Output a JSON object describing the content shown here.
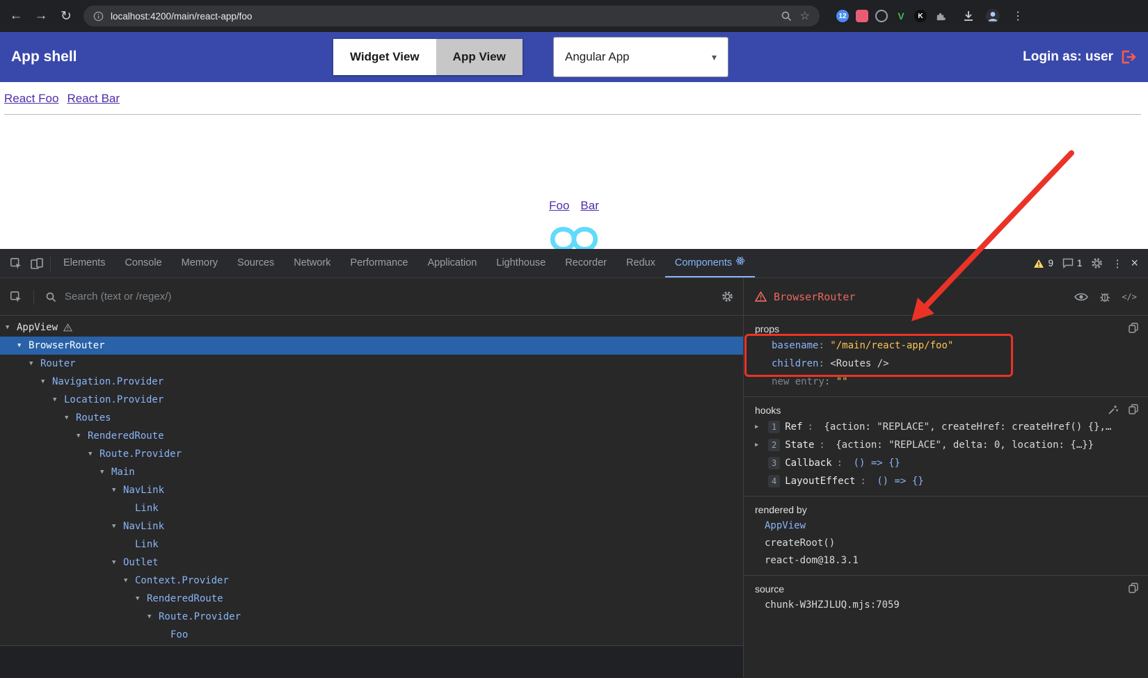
{
  "browser": {
    "url": "localhost:4200/main/react-app/foo",
    "extensions": [
      {
        "name": "updates-badge-extension-icon",
        "shape": "circle",
        "color": "#4d8bf0",
        "text_color": "#ffffff",
        "label": "12"
      },
      {
        "name": "adblock-extension-icon",
        "shape": "square",
        "color": "#e85d75",
        "text_color": "#ffffff",
        "label": ""
      },
      {
        "name": "ring-extension-icon",
        "shape": "ring",
        "color": "#9aa0a6",
        "text_color": "#9aa0a6",
        "label": ""
      },
      {
        "name": "v-extension-icon",
        "shape": "text",
        "color": "transparent",
        "text_color": "#3fba54",
        "label": "V"
      },
      {
        "name": "k-extension-icon",
        "shape": "circle",
        "color": "#101010",
        "text_color": "#ffffff",
        "label": "K"
      },
      {
        "name": "puzzle-extension-icon",
        "shape": "puzzle",
        "color": "#9aa0a6",
        "text_color": "#9aa0a6",
        "label": ""
      }
    ]
  },
  "app_header": {
    "title": "App shell",
    "view_toggle": {
      "widget_label": "Widget View",
      "app_label": "App View",
      "selected": "App View"
    },
    "app_select_value": "Angular App",
    "login_label": "Login as: user"
  },
  "page": {
    "nav_links": [
      "React Foo",
      "React Bar"
    ],
    "center_links": [
      "Foo",
      "Bar"
    ]
  },
  "devtools": {
    "tabs": [
      "Elements",
      "Console",
      "Memory",
      "Sources",
      "Network",
      "Performance",
      "Application",
      "Lighthouse",
      "Recorder",
      "Redux",
      "Components"
    ],
    "selected_tab": "Components",
    "warning_count": "9",
    "message_count": "1",
    "search_placeholder": "Search (text or /regex/)",
    "tree": [
      {
        "label": "AppView",
        "depth": 0,
        "arrow": true,
        "warning": true
      },
      {
        "label": "BrowserRouter",
        "depth": 1,
        "arrow": true,
        "selected": true
      },
      {
        "label": "Router",
        "depth": 2,
        "arrow": true
      },
      {
        "label": "Navigation.Provider",
        "depth": 3,
        "arrow": true
      },
      {
        "label": "Location.Provider",
        "depth": 4,
        "arrow": true
      },
      {
        "label": "Routes",
        "depth": 5,
        "arrow": true
      },
      {
        "label": "RenderedRoute",
        "depth": 6,
        "arrow": true
      },
      {
        "label": "Route.Provider",
        "depth": 7,
        "arrow": true
      },
      {
        "label": "Main",
        "depth": 8,
        "arrow": true
      },
      {
        "label": "NavLink",
        "depth": 9,
        "arrow": true
      },
      {
        "label": "Link",
        "depth": 10,
        "arrow": false
      },
      {
        "label": "NavLink",
        "depth": 9,
        "arrow": true
      },
      {
        "label": "Link",
        "depth": 10,
        "arrow": false
      },
      {
        "label": "Outlet",
        "depth": 9,
        "arrow": true
      },
      {
        "label": "Context.Provider",
        "depth": 10,
        "arrow": true
      },
      {
        "label": "RenderedRoute",
        "depth": 11,
        "arrow": true
      },
      {
        "label": "Route.Provider",
        "depth": 12,
        "arrow": true
      },
      {
        "label": "Foo",
        "depth": 13,
        "arrow": false
      }
    ],
    "inspector": {
      "component": "BrowserRouter",
      "props_title": "props",
      "props": [
        {
          "key": "basename",
          "value": "\"/main/react-app/foo\"",
          "kind": "string"
        },
        {
          "key": "children",
          "value": "<Routes />",
          "kind": "element"
        }
      ],
      "new_entry": {
        "key": "new entry",
        "value": "\"\""
      },
      "hooks_title": "hooks",
      "hooks": [
        {
          "index": "1",
          "name": "Ref",
          "value": "{action: \"REPLACE\", createHref: createHref() {},…",
          "expandable": true,
          "kind": "object"
        },
        {
          "index": "2",
          "name": "State",
          "value": "{action: \"REPLACE\", delta: 0, location: {…}}",
          "expandable": true,
          "kind": "object"
        },
        {
          "index": "3",
          "name": "Callback",
          "value": "() => {}",
          "expandable": false,
          "kind": "function"
        },
        {
          "index": "4",
          "name": "LayoutEffect",
          "value": "() => {}",
          "expandable": false,
          "kind": "function"
        }
      ],
      "rendered_by_title": "rendered by",
      "rendered_by": [
        {
          "label": "AppView",
          "link": true
        },
        {
          "label": "createRoot()",
          "link": false
        },
        {
          "label": "react-dom@18.3.1",
          "link": false
        }
      ],
      "source_title": "source",
      "source_value": "chunk-W3HZJLUQ.mjs:7059"
    }
  },
  "colors": {
    "header_indigo": "#3949ab",
    "annotation_red": "#ea3326",
    "selected_row_blue": "#2962a8",
    "component_error_red": "#e8685e",
    "string_yellow": "#f8c555",
    "link_blue": "#8ab4f8",
    "react_cyan": "#61dafb",
    "page_link_purple": "#512da8"
  }
}
